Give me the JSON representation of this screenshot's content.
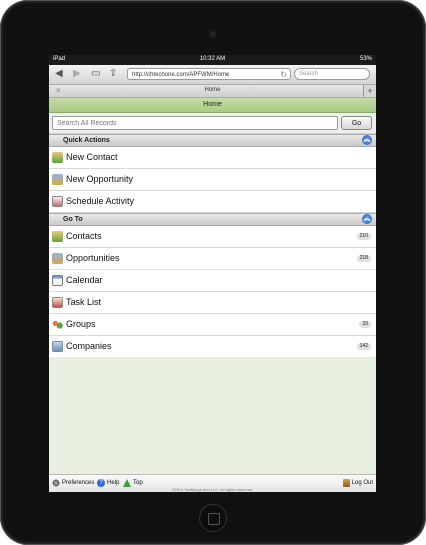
{
  "status_bar": {
    "carrier": "iPad",
    "time": "10:32 AM",
    "battery": "53%"
  },
  "browser": {
    "url": "http://chtechone.com/APFWM/Home",
    "search_placeholder": "Search",
    "tab_title": "Home"
  },
  "page": {
    "header_title": "Home"
  },
  "search": {
    "placeholder": "Search All Records",
    "button_label": "Go"
  },
  "quick_actions": {
    "title": "Quick Actions",
    "items": [
      {
        "label": "New Contact",
        "icon": "contact-add-icon"
      },
      {
        "label": "New Opportunity",
        "icon": "opportunity-add-icon"
      },
      {
        "label": "Schedule Activity",
        "icon": "schedule-icon"
      }
    ]
  },
  "go_to": {
    "title": "Go To",
    "items": [
      {
        "label": "Contacts",
        "count": "210",
        "icon": "contacts-icon"
      },
      {
        "label": "Opportunities",
        "count": "218",
        "icon": "opportunities-icon"
      },
      {
        "label": "Calendar",
        "count": "",
        "icon": "calendar-icon"
      },
      {
        "label": "Task List",
        "count": "",
        "icon": "task-list-icon"
      },
      {
        "label": "Groups",
        "count": "33",
        "icon": "groups-icon"
      },
      {
        "label": "Companies",
        "count": "142",
        "icon": "companies-icon"
      }
    ]
  },
  "footer": {
    "preferences": "Preferences",
    "help": "Help",
    "top": "Top",
    "logout": "Log Out",
    "copyright": "©2011 Swiftpage Act! LLC. All rights reserved."
  },
  "colors": {
    "header_green": "#b6d394",
    "accent_blue": "#1c56c8",
    "background_green": "#e7f0df"
  }
}
